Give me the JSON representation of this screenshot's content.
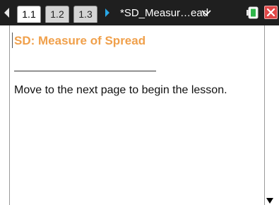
{
  "tabs": [
    {
      "label": "1.1",
      "active": true
    },
    {
      "label": "1.2",
      "active": false
    },
    {
      "label": "1.3",
      "active": false
    }
  ],
  "document": {
    "title": "*SD_Measur…ead"
  },
  "content": {
    "heading": "SD:  Measure of Spread",
    "body": "Move to the next page to begin the lesson."
  },
  "icons": {
    "prev_page": "left-arrow-icon",
    "next_page": "right-arrow-icon",
    "document_menu": "chevron-down-icon",
    "battery": "battery-icon",
    "close": "close-icon",
    "scroll": "scroll-down-icon"
  },
  "colors": {
    "tabbar_bg": "#1f1f1f",
    "heading": "#f0a04b",
    "accent_arrow": "#28a7e6",
    "close_bg": "#e04848",
    "battery": "#2fb64a"
  }
}
